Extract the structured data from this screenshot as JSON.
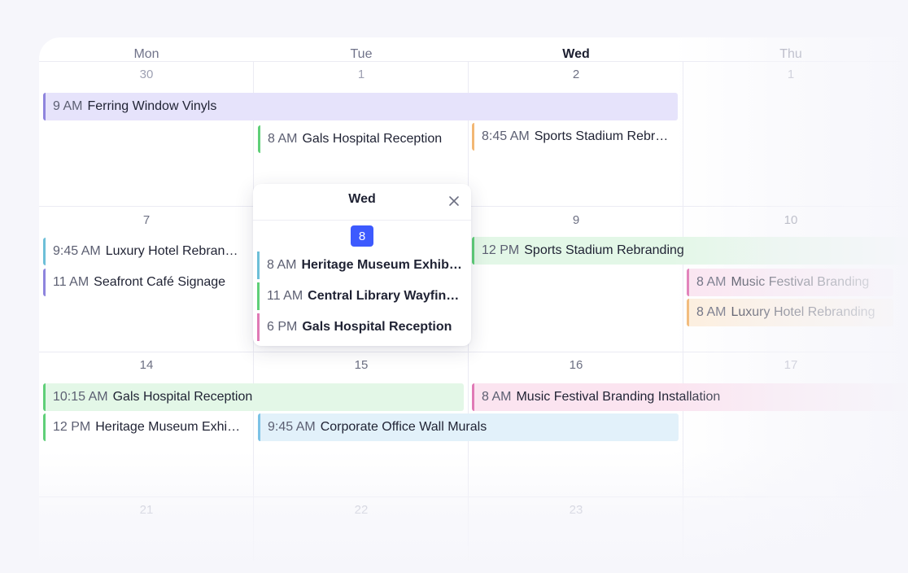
{
  "calendar": {
    "headers": [
      "Mon",
      "Tue",
      "Wed",
      "Thu"
    ],
    "weeks": [
      [
        "30",
        "1",
        "2",
        "1"
      ],
      [
        "7",
        "8",
        "9",
        "10"
      ],
      [
        "14",
        "15",
        "16",
        "17"
      ],
      [
        "21",
        "22",
        "23",
        ""
      ]
    ]
  },
  "events": [
    {
      "time": "9 AM",
      "name": "Ferring Window Vinyls"
    },
    {
      "time": "8 AM",
      "name": "Gals Hospital Reception"
    },
    {
      "time": "8:45 AM",
      "name": "Sports Stadium Rebranding"
    },
    {
      "time": "9:45 AM",
      "name": "Luxury Hotel Rebranding"
    },
    {
      "time": "11 AM",
      "name": "Seafront Café Signage"
    },
    {
      "time": "12 PM",
      "name": "Sports Stadium Rebranding"
    },
    {
      "time": "8 AM",
      "name": "Music Festival Branding"
    },
    {
      "time": "8 AM",
      "name": "Luxury Hotel Rebranding"
    },
    {
      "time": "10:15 AM",
      "name": "Gals Hospital Reception"
    },
    {
      "time": "8 AM",
      "name": "Music Festival Branding Installation"
    },
    {
      "time": "12 PM",
      "name": "Heritage Museum Exhibition"
    },
    {
      "time": "9:45 AM",
      "name": "Corporate Office Wall Murals"
    }
  ],
  "popup": {
    "title": "Wed",
    "date": "8",
    "events": [
      {
        "time": "8 AM",
        "name": "Heritage Museum Exhibition"
      },
      {
        "time": "11 AM",
        "name": "Central Library Wayfinding"
      },
      {
        "time": "6 PM",
        "name": "Gals Hospital Reception"
      }
    ]
  },
  "colors": {
    "accent": "#3d5afe",
    "purple": "#8e84dd",
    "green": "#5fcf78",
    "orange": "#f2b774",
    "teal": "#6dbfd8",
    "pink": "#e07ab6",
    "blue": "#7cc2e6"
  }
}
